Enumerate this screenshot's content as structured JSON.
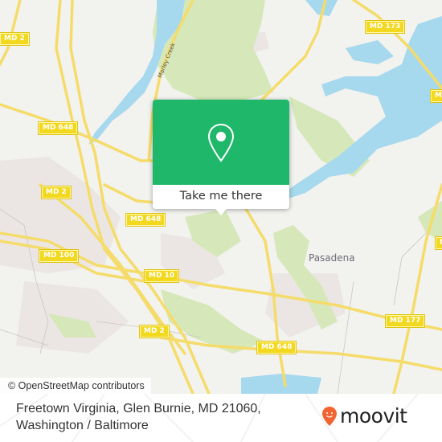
{
  "map": {
    "road_shields": [
      {
        "label": "MD 2"
      },
      {
        "label": "MD 648"
      },
      {
        "label": "MD 173"
      },
      {
        "label": "MD 2"
      },
      {
        "label": "MD 648"
      },
      {
        "label": "MD 100"
      },
      {
        "label": "MD 10"
      },
      {
        "label": "MD 2"
      },
      {
        "label": "MD 648"
      },
      {
        "label": "MD 177"
      },
      {
        "label": "MD"
      },
      {
        "label": "MD"
      }
    ],
    "place_labels": [
      {
        "label": "Pasadena"
      }
    ],
    "water_labels": [
      {
        "label": "Marley Creek"
      }
    ],
    "attribution": "© OpenStreetMap contributors"
  },
  "popup": {
    "icon": "location-pin-icon",
    "button_label": "Take me there",
    "color": "#1fb86a"
  },
  "footer": {
    "address_line1": "Freetown Virginia, Glen Burnie, MD 21060,",
    "address_line2": "Washington / Baltimore",
    "brand": "moovit",
    "brand_color": "#f26532"
  }
}
